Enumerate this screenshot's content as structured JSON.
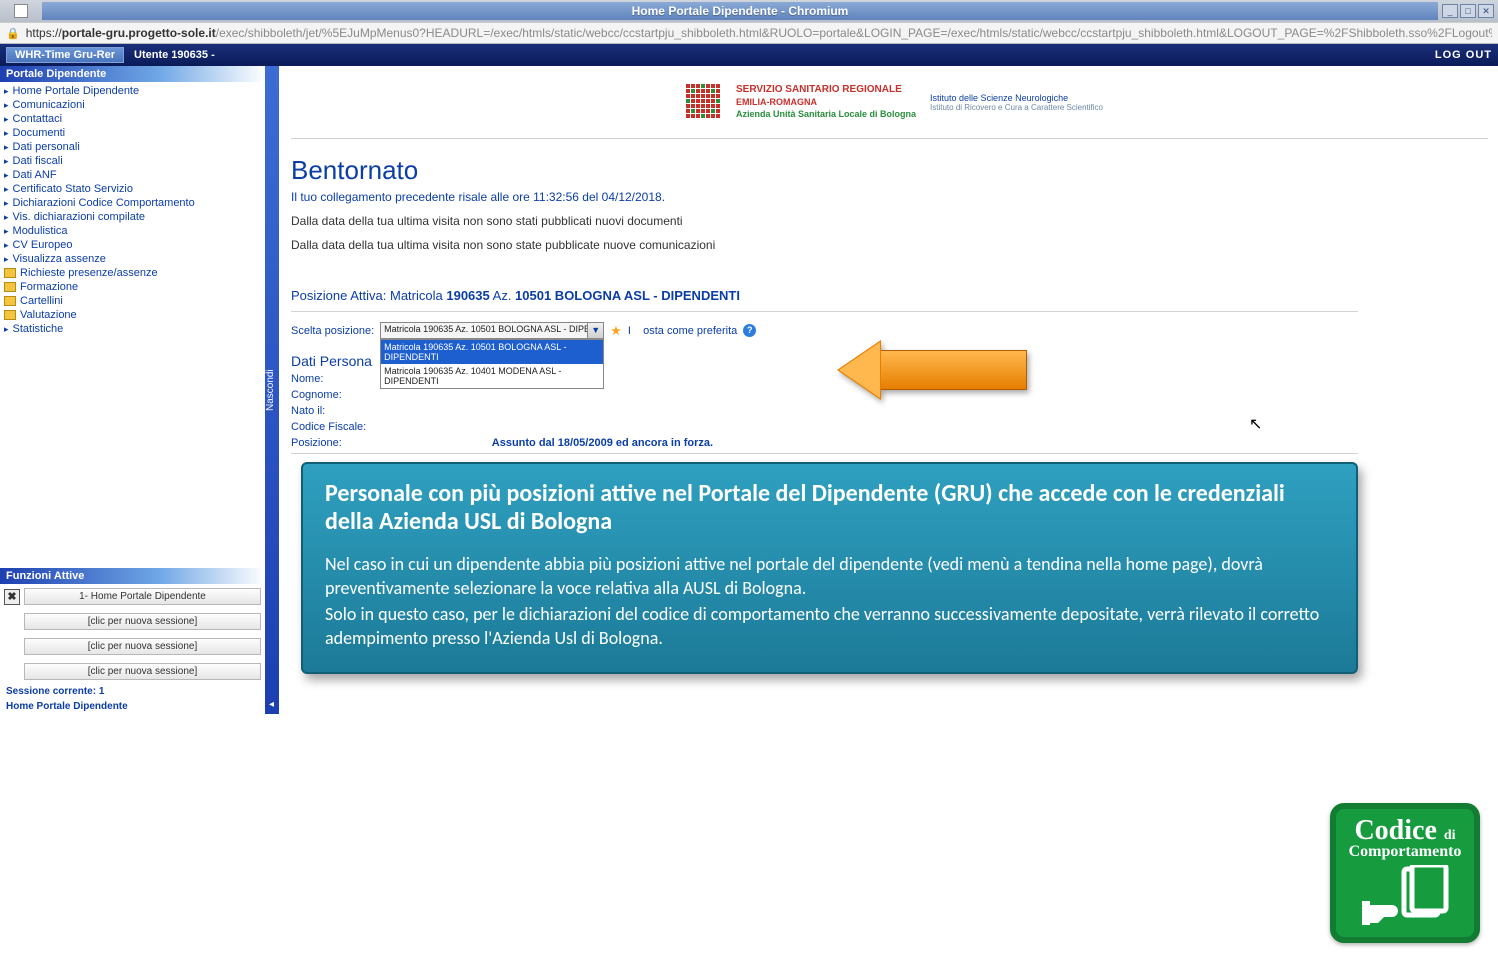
{
  "browser": {
    "title": "Home Portale Dipendente - Chromium",
    "url_secure_host": "portale-gru.progetto-sole.it",
    "url_path": "/exec/shibboleth/jet/%5EJuMpMenus0?HEADURL=/exec/htmls/static/webcc/ccstartpju_shibboleth.html&RUOLO=portale&LOGIN_PAGE=/exec/htmls/static/webcc/ccstartpju_shibboleth.html&LOGOUT_PAGE=%2FShibboleth.sso%2FLogout%3Fretu...",
    "win_min": "_",
    "win_max": "□",
    "win_close": "✕"
  },
  "app": {
    "title": "WHR-Time Gru-Rer",
    "user": "Utente 190635 -",
    "logout": "LOG OUT"
  },
  "sidebar": {
    "header1": "Portale Dipendente",
    "items": [
      {
        "label": "Home Portale Dipendente",
        "icon": "tri"
      },
      {
        "label": "Comunicazioni",
        "icon": "tri"
      },
      {
        "label": "Contattaci",
        "icon": "tri"
      },
      {
        "label": "Documenti",
        "icon": "tri"
      },
      {
        "label": "Dati personali",
        "icon": "tri"
      },
      {
        "label": "Dati fiscali",
        "icon": "tri"
      },
      {
        "label": "Dati ANF",
        "icon": "tri"
      },
      {
        "label": "Certificato Stato Servizio",
        "icon": "tri"
      },
      {
        "label": "Dichiarazioni Codice Comportamento",
        "icon": "tri"
      },
      {
        "label": "Vis. dichiarazioni compilate",
        "icon": "tri"
      },
      {
        "label": "Modulistica",
        "icon": "tri"
      },
      {
        "label": "CV Europeo",
        "icon": "tri"
      },
      {
        "label": "Visualizza assenze",
        "icon": "tri"
      },
      {
        "label": "Richieste presenze/assenze",
        "icon": "folder"
      },
      {
        "label": "Formazione",
        "icon": "folder"
      },
      {
        "label": "Cartellini",
        "icon": "folder"
      },
      {
        "label": "Valutazione",
        "icon": "folder"
      },
      {
        "label": "Statistiche",
        "icon": "tri"
      }
    ],
    "header2": "Funzioni Attive",
    "close_x": "✖",
    "sess_main": "1- Home Portale Dipendente",
    "sess_new": "[clic per nuova sessione]",
    "sess_current_label": "Sessione corrente: 1",
    "sess_current_name": "Home Portale Dipendente",
    "nascondi": "Nascondi"
  },
  "logo": {
    "l1": "SERVIZIO SANITARIO REGIONALE",
    "l2": "EMILIA-ROMAGNA",
    "l3": "Azienda Unità Sanitaria Locale di Bologna",
    "ist1": "Istituto delle Scienze Neurologiche",
    "ist2": "Istituto di Ricovero e Cura a Carattere Scientifico"
  },
  "welcome": {
    "title": "Bentornato",
    "p1": "Il tuo collegamento precedente risale alle ore 11:32:56 del 04/12/2018.",
    "p2": "Dalla data della tua ultima visita non sono stati pubblicati nuovi documenti",
    "p3": "Dalla data della tua ultima visita non sono state pubblicate nuove comunicazioni"
  },
  "posizione": {
    "label": "Posizione Attiva: Matricola ",
    "matricola": "190635",
    "az_label": " Az. ",
    "az_val": "10501 BOLOGNA ASL - DIPENDENTI",
    "scelta_label": "Scelta posizione:",
    "selected": "Matricola 190635 Az. 10501 BOLOGNA ASL - DIPENDENTI",
    "options": [
      "Matricola 190635 Az. 10501 BOLOGNA ASL - DIPENDENTI",
      "Matricola 190635 Az. 10401 MODENA ASL - DIPENDENTI"
    ],
    "pref_label": "osta come preferita",
    "pref_prefix": "I"
  },
  "dati": {
    "header": "Dati Persona",
    "rows": [
      "Nome:",
      "Cognome:",
      "Nato il:",
      "Codice Fiscale:",
      "Posizione:"
    ],
    "pos_val": "Assunto dal 18/05/2009 ed ancora in forza."
  },
  "callout": {
    "title": "Personale con più posizioni attive nel Portale del Dipendente (GRU) che accede con le credenziali della Azienda USL di Bologna",
    "p1": "Nel caso in cui un  dipendente abbia più posizioni attive nel portale del dipendente (vedi menù a tendina nella home page), dovrà preventivamente selezionare la voce relativa alla AUSL di Bologna.",
    "p2": "Solo in questo caso, per  le dichiarazioni del codice di comportamento  che verranno successivamente depositate, verrà rilevato il corretto adempimento presso l'Azienda Usl di Bologna."
  },
  "badge": {
    "t1a": "Codice",
    "t1b": "di",
    "t2": "Comportamento"
  }
}
